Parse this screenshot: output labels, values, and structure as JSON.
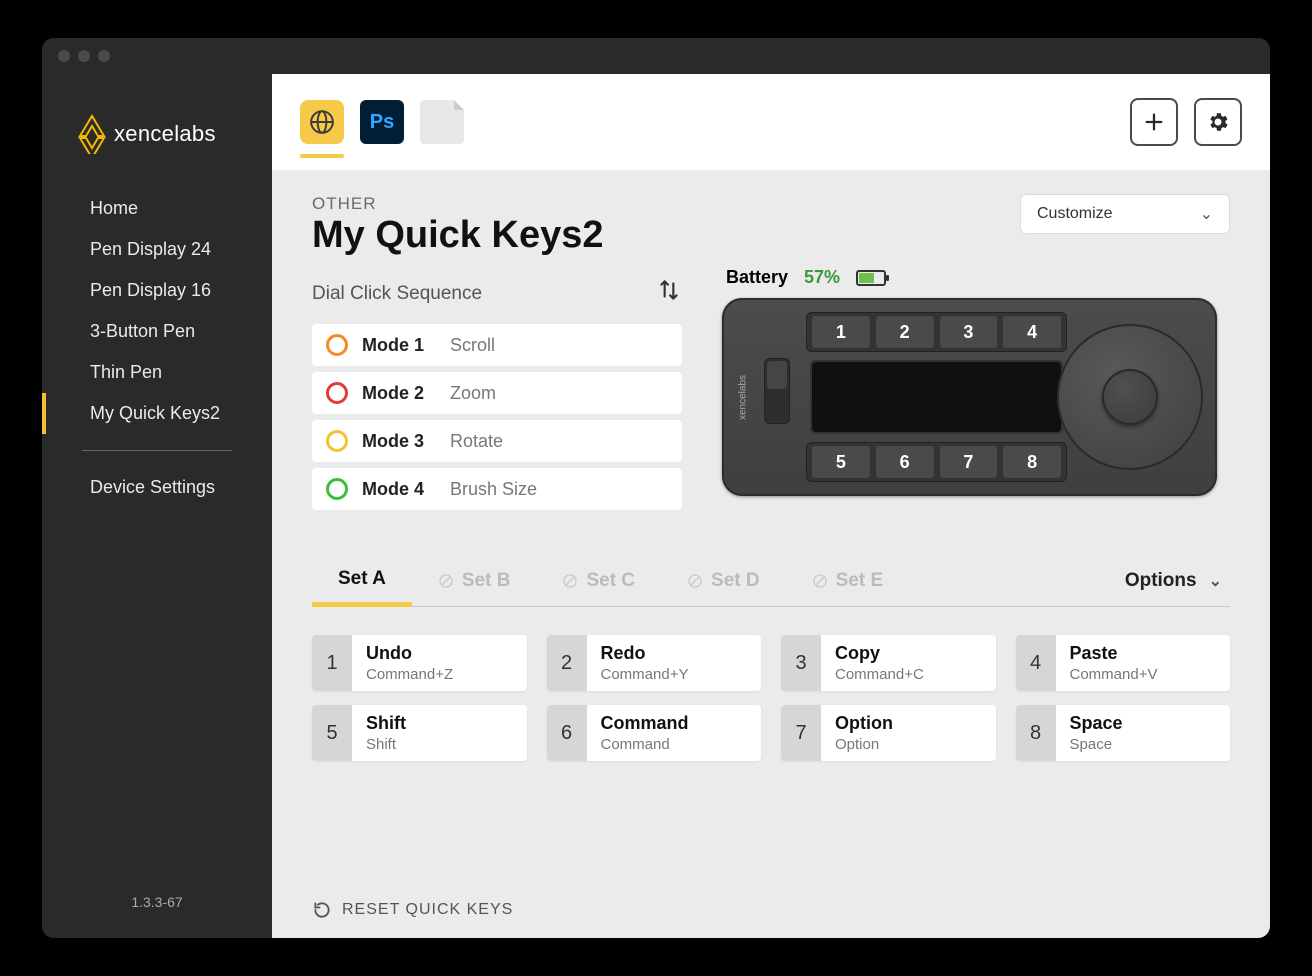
{
  "brand": "xencelabs",
  "version": "1.3.3-67",
  "sidebar": {
    "items": [
      {
        "label": "Home"
      },
      {
        "label": "Pen Display 24"
      },
      {
        "label": "Pen Display 16"
      },
      {
        "label": "3-Button Pen"
      },
      {
        "label": "Thin Pen"
      },
      {
        "label": "My Quick Keys2"
      }
    ],
    "settings_label": "Device Settings"
  },
  "topbar": {
    "apps": [
      {
        "id": "global",
        "name": "Global",
        "active": true
      },
      {
        "id": "ps",
        "name": "Photoshop",
        "glyph": "Ps"
      },
      {
        "id": "blank",
        "name": "Blank document"
      }
    ],
    "add_title": "Add application",
    "settings_title": "Settings"
  },
  "page": {
    "category": "OTHER",
    "title": "My Quick Keys2",
    "customize_label": "Customize"
  },
  "dial": {
    "title": "Dial Click Sequence",
    "modes": [
      {
        "name": "Mode 1",
        "action": "Scroll",
        "color": "#f28c28"
      },
      {
        "name": "Mode 2",
        "action": "Zoom",
        "color": "#e23b3b"
      },
      {
        "name": "Mode 3",
        "action": "Rotate",
        "color": "#f2c233"
      },
      {
        "name": "Mode 4",
        "action": "Brush Size",
        "color": "#3bbf3b"
      }
    ]
  },
  "battery": {
    "label": "Battery",
    "percent_text": "57%",
    "percent": 57
  },
  "device_keys_top": [
    "1",
    "2",
    "3",
    "4"
  ],
  "device_keys_bottom": [
    "5",
    "6",
    "7",
    "8"
  ],
  "sets": {
    "tabs": [
      {
        "label": "Set A",
        "enabled": true
      },
      {
        "label": "Set B",
        "enabled": false
      },
      {
        "label": "Set C",
        "enabled": false
      },
      {
        "label": "Set D",
        "enabled": false
      },
      {
        "label": "Set E",
        "enabled": false
      }
    ],
    "options_label": "Options"
  },
  "keys": [
    {
      "n": "1",
      "label": "Undo",
      "shortcut": "Command+Z"
    },
    {
      "n": "2",
      "label": "Redo",
      "shortcut": "Command+Y"
    },
    {
      "n": "3",
      "label": "Copy",
      "shortcut": "Command+C"
    },
    {
      "n": "4",
      "label": "Paste",
      "shortcut": "Command+V"
    },
    {
      "n": "5",
      "label": "Shift",
      "shortcut": "Shift"
    },
    {
      "n": "6",
      "label": "Command",
      "shortcut": "Command"
    },
    {
      "n": "7",
      "label": "Option",
      "shortcut": "Option"
    },
    {
      "n": "8",
      "label": "Space",
      "shortcut": "Space"
    }
  ],
  "reset_label": "RESET QUICK KEYS"
}
